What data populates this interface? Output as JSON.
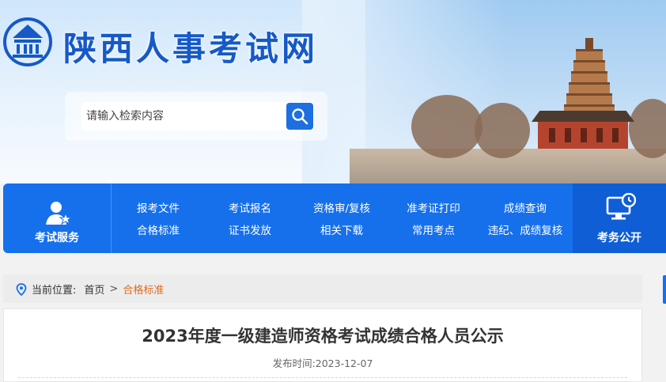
{
  "site": {
    "title": "陕西人事考试网"
  },
  "search": {
    "placeholder": "请输入检索内容"
  },
  "nav": {
    "left_label": "考试服务",
    "columns": [
      {
        "top": "报考文件",
        "bottom": "合格标准"
      },
      {
        "top": "考试报名",
        "bottom": "证书发放"
      },
      {
        "top": "资格审/复核",
        "bottom": "相关下载"
      },
      {
        "top": "准考证打印",
        "bottom": "常用考点"
      },
      {
        "top": "成绩查询",
        "bottom": "违纪、成绩复核"
      }
    ],
    "right_label": "考务公开"
  },
  "breadcrumb": {
    "prefix": "当前位置:",
    "home": "首页",
    "separator": ">",
    "current": "合格标准"
  },
  "article": {
    "title": "2023年度一级建造师资格考试成绩合格人员公示",
    "date_label": "发布时间:",
    "date": "2023-12-07"
  },
  "colors": {
    "nav_blue": "#1670ec",
    "accent_orange": "#e06b1e",
    "title_blue": "#1659c7"
  }
}
